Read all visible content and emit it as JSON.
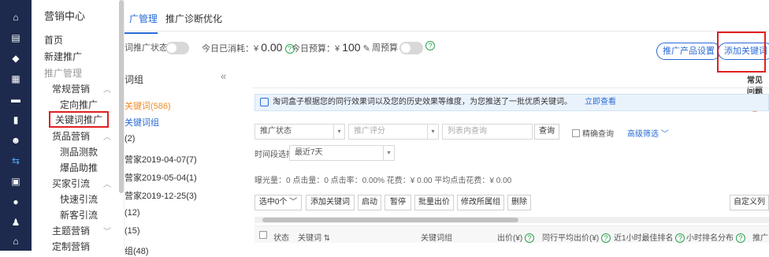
{
  "nav": {
    "title": "营销中心",
    "items": [
      "首页",
      "新建推广",
      "推广管理",
      "常规营销",
      "定向推广",
      "关键词推广",
      "货品营销",
      "测品测款",
      "爆品助推",
      "买家引流",
      "快速引流",
      "新客引流",
      "主题营销",
      "定制营销"
    ]
  },
  "tabs": [
    "广管理",
    "推广诊断优化"
  ],
  "summary": {
    "status_label": "词推广状态:",
    "spent_label": "今日已消耗：",
    "spent_currency": "¥",
    "spent_value": "0.00",
    "budget_label": "今日预算：",
    "budget_currency": "¥",
    "budget_value": "100",
    "weekly_label": "周预算"
  },
  "actions": {
    "product_settings": "推广产品设置",
    "add_keyword": "添加关键词"
  },
  "faq": "常见问题",
  "groups": {
    "header": "词组",
    "items": [
      "关键词(586)",
      "关键词组",
      "(2)",
      "营家2019-04-07(7)",
      "营家2019-05-04(1)",
      "营家2019-12-25(3)",
      "(12)",
      "(15)",
      "组(48)"
    ]
  },
  "notice": {
    "text": "淘词盒子根据您的同行效果词以及您的历史效果等维度，为您推送了一批优质关键词。",
    "link": "立即查看"
  },
  "filters": {
    "status": "推广状态",
    "rating": "推广评分",
    "search_placeholder": "列表内查询",
    "search_btn": "查询",
    "exact": "精确查询",
    "advanced": "高级筛选",
    "period_label": "时间段选择",
    "period_value": "最近7天"
  },
  "stats": "曝光量：0   点击量：0   点击率：0.00%   花费：¥ 0.00   平均点击花费：¥ 0.00",
  "toolbar": {
    "selected": "选中0个",
    "buttons": [
      "添加关键词",
      "启动",
      "暂停",
      "批量出价",
      "修改所属组",
      "删除"
    ],
    "custom": "自定义列"
  },
  "table_headers": [
    "状态",
    "关键词",
    "关键词组",
    "出价(¥)",
    "同行平均出价(¥)",
    "近1小时最佳排名",
    "小时排名分布",
    "推广"
  ],
  "colors": {
    "accent": "#2a6bd6",
    "highlight": "#e02020",
    "rail": "#1d2a4d",
    "orange": "#f28c28"
  }
}
